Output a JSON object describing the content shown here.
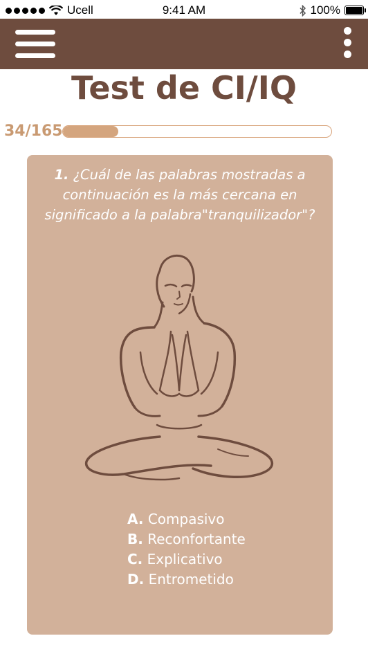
{
  "status_bar": {
    "carrier": "Ucell",
    "time": "9:41 AM",
    "battery": "100%",
    "icons": [
      "signal-dots-icon",
      "wifi-icon",
      "bluetooth-icon",
      "battery-icon"
    ]
  },
  "app_bar": {
    "menu_icon": "hamburger-menu-icon",
    "overflow_icon": "more-vertical-icon",
    "background": "#6e4c3e"
  },
  "title": "Test de CI/IQ",
  "progress": {
    "label": "34/165",
    "current": 34,
    "total": 165,
    "fill_color": "#d4a57e"
  },
  "question": {
    "number": "1.",
    "text": "¿Cuál de las palabras mostradas a continuación es  la más cercana en significado a la palabra\"tranquilizador\"?",
    "illustration": "meditating-person-lotus-pose"
  },
  "options": [
    {
      "letter": "A.",
      "text": "Compasivo"
    },
    {
      "letter": "B.",
      "text": "Reconfortante"
    },
    {
      "letter": "C.",
      "text": "Explicativo"
    },
    {
      "letter": "D.",
      "text": "Entrometido"
    }
  ],
  "colors": {
    "brand": "#6e4c3e",
    "card": "#d2b19a",
    "progress_label": "#c99a72"
  }
}
